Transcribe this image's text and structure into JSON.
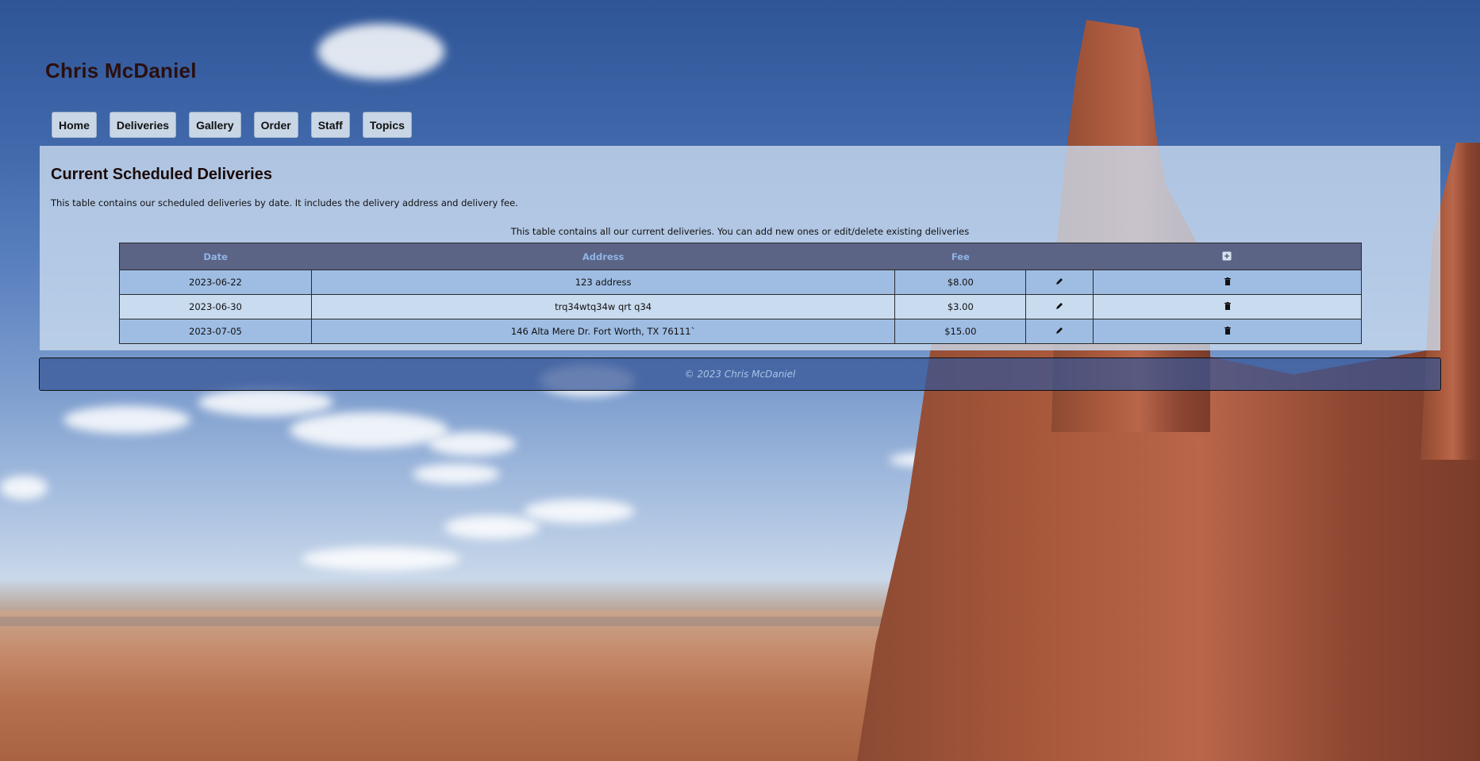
{
  "site": {
    "title": "Chris McDaniel"
  },
  "nav": {
    "items": [
      "Home",
      "Deliveries",
      "Gallery",
      "Order",
      "Staff",
      "Topics"
    ]
  },
  "main": {
    "heading": "Current Scheduled Deliveries",
    "intro": "This table contains our scheduled deliveries by date. It includes the delivery address and delivery fee.",
    "caption": "This table contains all our current deliveries. You can add new ones or edit/delete existing deliveries",
    "table": {
      "headers": {
        "date": "Date",
        "address": "Address",
        "fee": "Fee"
      },
      "add_icon": "plus-square-icon",
      "edit_icon": "pencil-icon",
      "delete_icon": "trash-icon",
      "rows": [
        {
          "date": "2023-06-22",
          "address": "123 address",
          "fee": "$8.00"
        },
        {
          "date": "2023-06-30",
          "address": "trq34wtq34w qrt q34",
          "fee": "$3.00"
        },
        {
          "date": "2023-07-05",
          "address": "146 Alta Mere Dr. Fort Worth, TX 76111`",
          "fee": "$15.00"
        }
      ]
    }
  },
  "footer": {
    "text": "© 2023 Chris McDaniel"
  },
  "colors": {
    "header_row": "#5c6485",
    "header_text": "#8fb4e6",
    "row_odd": "#9fbde3",
    "row_even": "#c9dbef"
  }
}
